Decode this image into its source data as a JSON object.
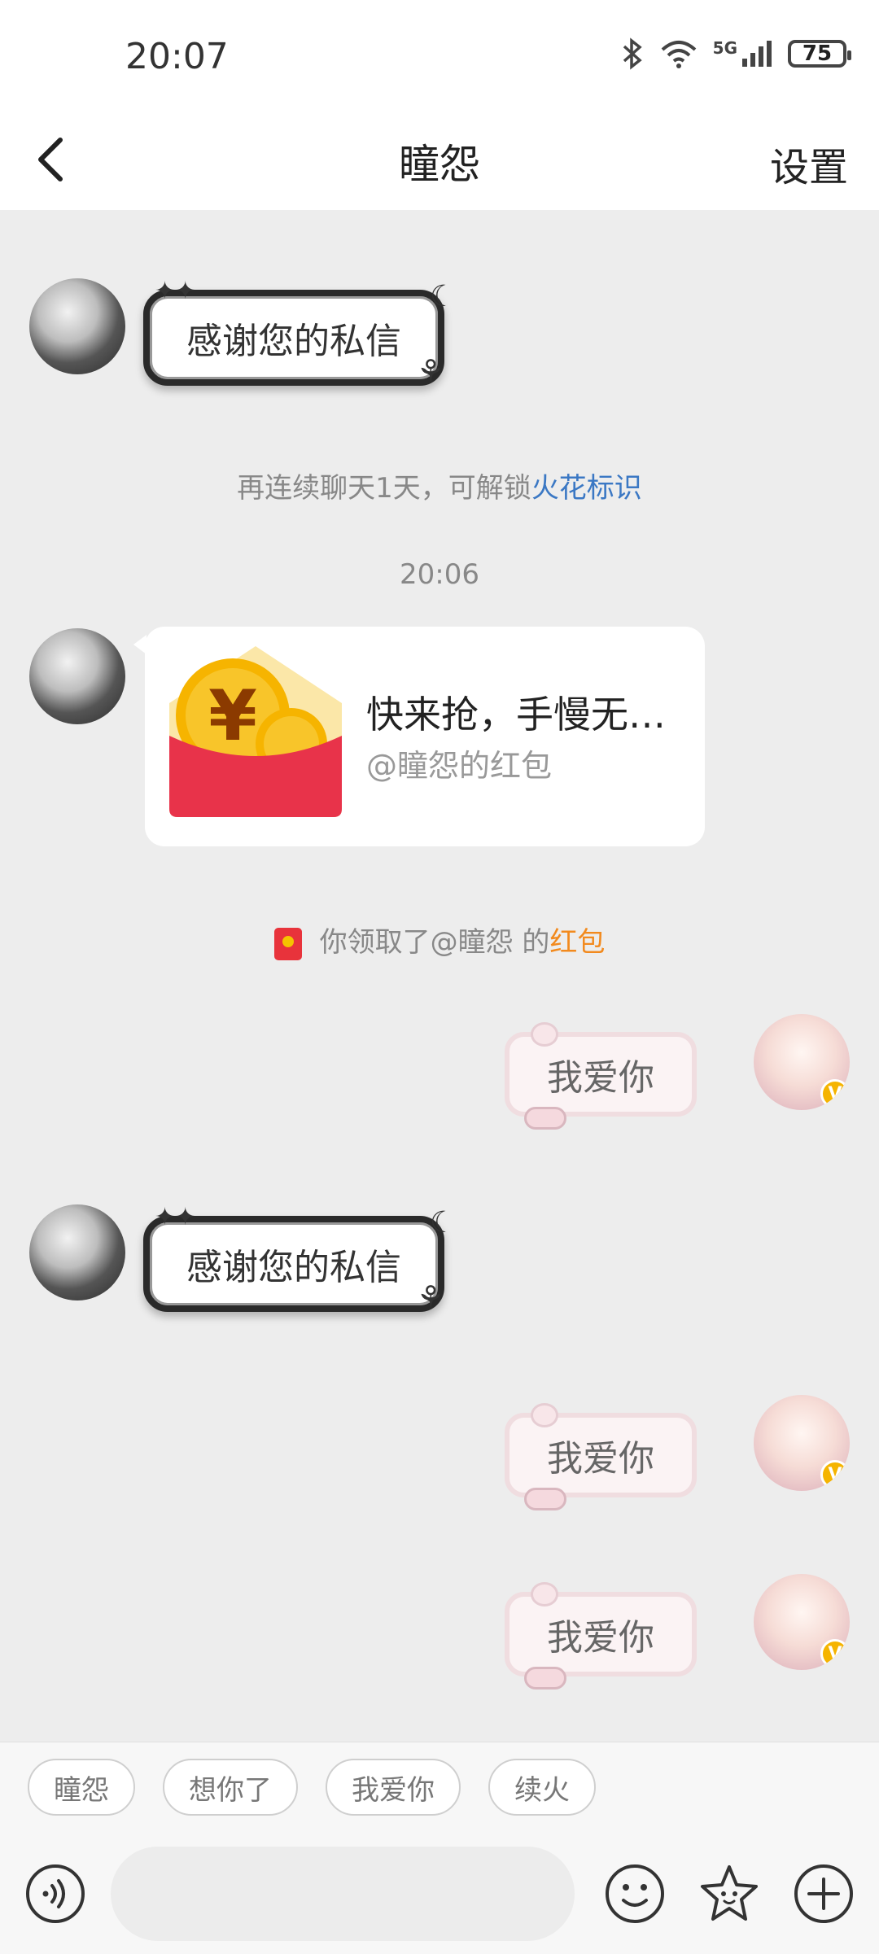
{
  "status": {
    "time": "20:07",
    "network": "5G",
    "battery": "75"
  },
  "nav": {
    "title": "瞳怨",
    "settings": "设置"
  },
  "messages": {
    "thanks_1": "感谢您的私信",
    "streak_prefix": "再连续聊天1天，可解锁",
    "streak_link": "火花标识",
    "timestamp": "20:06",
    "redpacket_title": "快来抢，手慢无…",
    "redpacket_sub": "@瞳怨的红包",
    "received_prefix": "你领取了@瞳怨 的",
    "received_link": "红包",
    "love_1": "我爱你",
    "thanks_2": "感谢您的私信",
    "love_2": "我爱你",
    "love_3": "我爱你",
    "vip_badge": "V"
  },
  "quick_replies": [
    "瞳怨",
    "想你了",
    "我爱你",
    "续火"
  ],
  "composer": {
    "placeholder": ""
  },
  "colors": {
    "chat_bg": "#ededed",
    "link_blue": "#3b78c4",
    "link_orange": "#f28a1e",
    "red_packet": "#e8333b"
  }
}
